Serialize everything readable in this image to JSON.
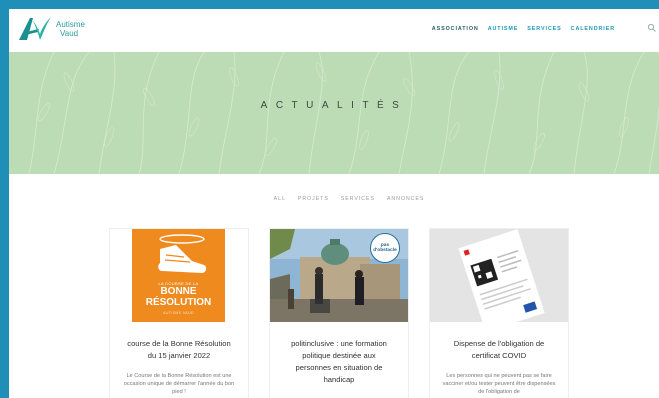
{
  "brand": {
    "line1": "Autisme",
    "line2": "Vaud",
    "logo_letter": "AV"
  },
  "nav": [
    "Association",
    "Autisme",
    "Services",
    "Calendrier"
  ],
  "hero": {
    "title": "ACTUALITÉS"
  },
  "filters": [
    "All",
    "Projets",
    "Services",
    "Annonces"
  ],
  "cards": [
    {
      "image_top": "LA COURSE DE LA",
      "image_big1": "BONNE",
      "image_big2": "RÉSOLUTION",
      "image_bottom": "AUTISME VAUD",
      "title": "course de la Bonne Résolution du 15 janvier 2022",
      "excerpt": "Le Course de la Bonne Résolution est une occasion unique de démarrer l'année du bon pied !"
    },
    {
      "badge": "pas d'obstacle",
      "title": "politinclusive : une formation politique destinée aux personnes en situation de handicap",
      "excerpt": ""
    },
    {
      "title": "Dispense de l'obligation de certificat COVID",
      "excerpt": "Les personnes qui ne peuvent pas se faire vacciner et/ou tester peuvent être dispensées de l'obligation de"
    }
  ],
  "colors": {
    "frame": "#1f8fb8",
    "hero": "#bcdcb5",
    "accent": "#1c9bb1",
    "orange": "#ef8a1e"
  }
}
